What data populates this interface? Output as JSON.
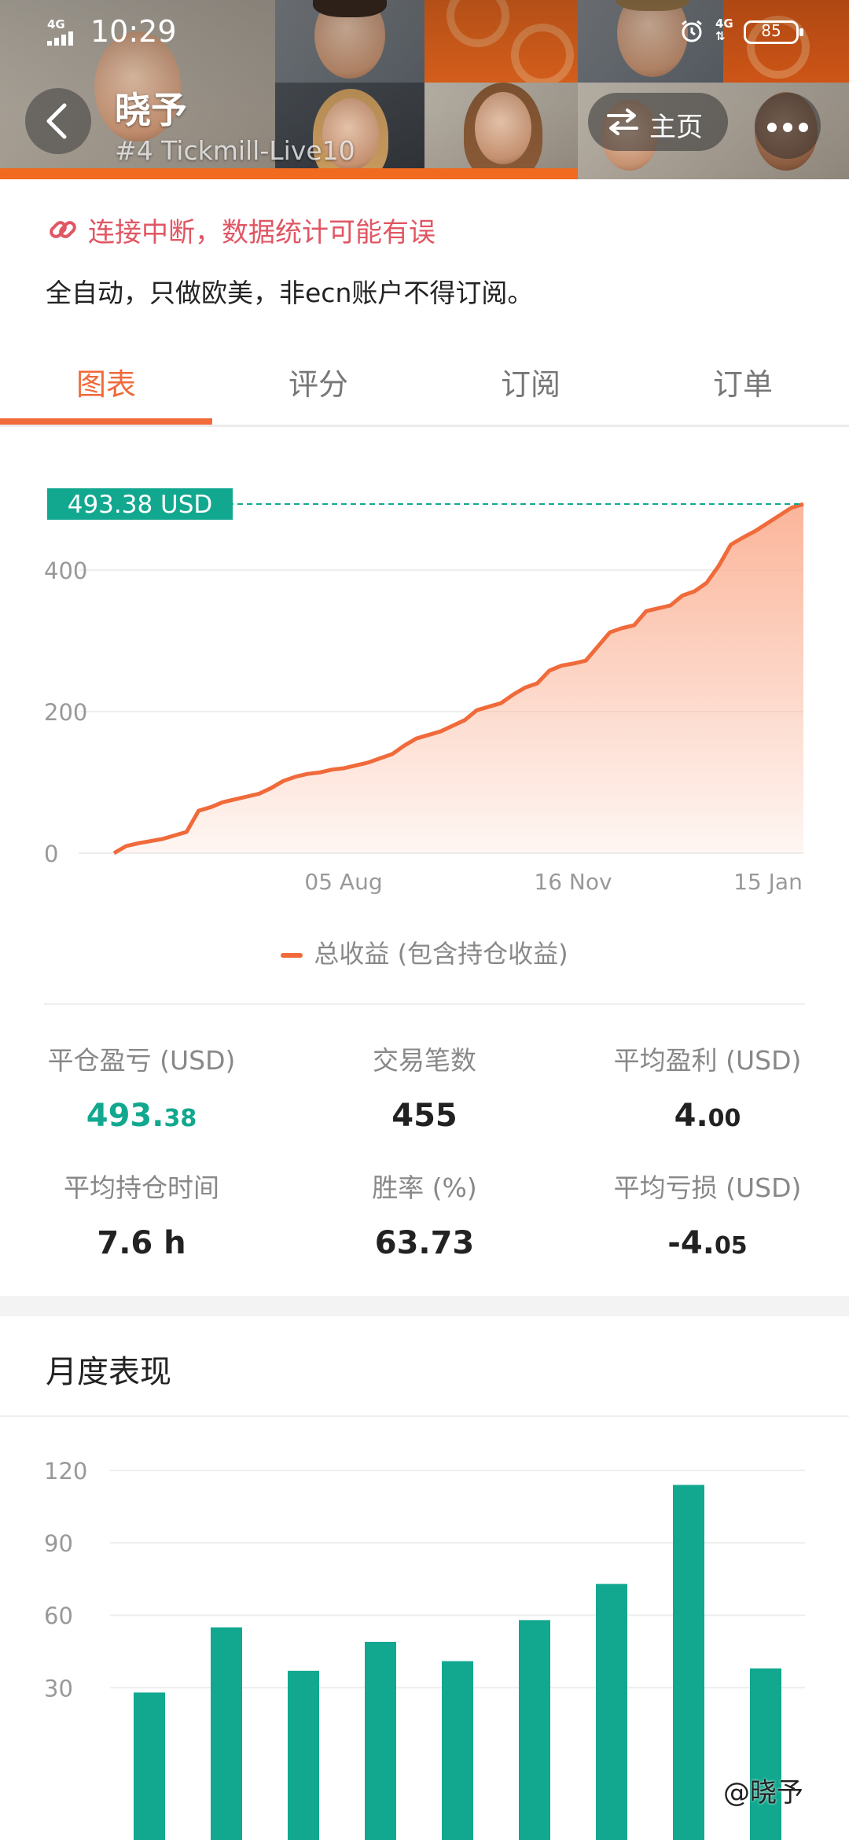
{
  "status_bar": {
    "network": "4G",
    "time": "10:29",
    "network2": "4G",
    "battery": "85"
  },
  "header": {
    "name": "晓予",
    "subtitle": "#4   Tickmill-Live10",
    "home_label": "主页"
  },
  "info": {
    "warning": "连接中断，数据统计可能有误",
    "description": "全自动，只做欧美，非ecn账户不得订阅。"
  },
  "tabs": [
    "图表",
    "评分",
    "订阅",
    "订单"
  ],
  "chart_data": [
    {
      "type": "area",
      "current_label": "493.38 USD",
      "current_value": 493.38,
      "y_ticks": [
        "0",
        "200",
        "400"
      ],
      "ylim": [
        0,
        600
      ],
      "x_tick_labels": [
        "05 Aug",
        "16 Nov",
        "15 Jan"
      ],
      "legend": "总收益 (包含持仓收益)",
      "y": [
        0,
        10,
        14,
        17,
        20,
        25,
        30,
        60,
        65,
        72,
        76,
        80,
        84,
        92,
        102,
        108,
        112,
        114,
        118,
        120,
        124,
        128,
        134,
        140,
        152,
        162,
        167,
        172,
        180,
        188,
        202,
        207,
        212,
        224,
        234,
        240,
        258,
        265,
        268,
        272,
        292,
        312,
        318,
        322,
        342,
        346,
        350,
        364,
        370,
        382,
        406,
        436,
        446,
        455,
        466,
        477,
        488,
        493.38
      ],
      "colors": {
        "line": "#f06a3a",
        "fill_top": "#fbb59a",
        "label_bg": "#12a88f"
      }
    },
    {
      "type": "bar",
      "y_ticks": [
        "30",
        "60",
        "90",
        "120"
      ],
      "ylim": [
        0,
        125
      ],
      "values": [
        28,
        55,
        37,
        49,
        41,
        58,
        73,
        114,
        38
      ],
      "colors": {
        "bar": "#12a88f"
      }
    }
  ],
  "stats": [
    {
      "label": "平仓盈亏 (USD)",
      "value_main": "493.",
      "value_small": "38",
      "green": true
    },
    {
      "label": "交易笔数",
      "value_main": "455",
      "value_small": "",
      "green": false
    },
    {
      "label": "平均盈利 (USD)",
      "value_main": "4.",
      "value_small": "00",
      "green": false
    },
    {
      "label": "平均持仓时间",
      "value_main": "7.6 h",
      "value_small": "",
      "green": false
    },
    {
      "label": "胜率 (%)",
      "value_main": "63.73",
      "value_small": "",
      "green": false
    },
    {
      "label": "平均亏损 (USD)",
      "value_main": "-4.",
      "value_small": "05",
      "green": false
    }
  ],
  "monthly": {
    "title": "月度表现"
  },
  "watermark": "@晓予"
}
